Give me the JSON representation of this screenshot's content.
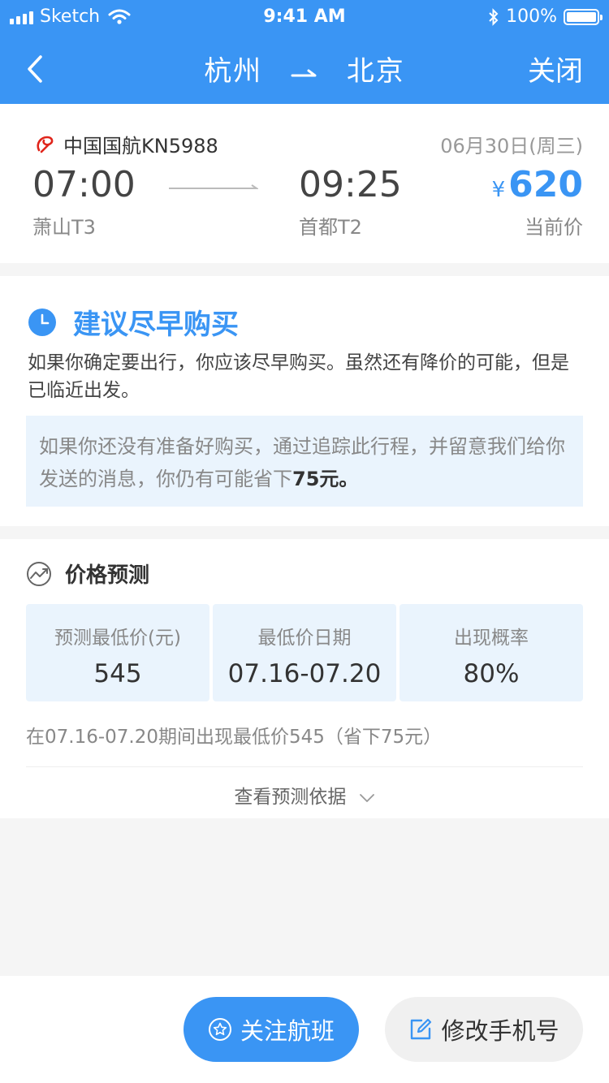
{
  "status_bar": {
    "carrier": "Sketch",
    "time": "9:41 AM",
    "battery": "100%"
  },
  "nav": {
    "origin": "杭州",
    "destination": "北京",
    "close_label": "关闭"
  },
  "flight": {
    "airline": "中国国航KN5988",
    "date": "06月30日(周三)",
    "dep_time": "07:00",
    "arr_time": "09:25",
    "dep_airport": "萧山T3",
    "arr_airport": "首都T2",
    "price_symbol": "¥",
    "price": "620",
    "price_label": "当前价"
  },
  "advice": {
    "title": "建议尽早购买",
    "text": "如果你确定要出行，你应该尽早购买。虽然还有降价的可能，但是已临近出发。",
    "tip_prefix": "如果你还没有准备好购买，通过追踪此行程，并留意我们给你发送的消息，你仍有可能省下",
    "tip_highlight": "75元。"
  },
  "prediction": {
    "title": "价格预测",
    "stats": [
      {
        "label": "预测最低价(元)",
        "value": "545"
      },
      {
        "label": "最低价日期",
        "value": "07.16-07.20"
      },
      {
        "label": "出现概率",
        "value": "80%"
      }
    ],
    "summary": "在07.16-07.20期间出现最低价545（省下75元）",
    "view_basis_label": "查看预测依据"
  },
  "actions": {
    "follow_label": "关注航班",
    "edit_phone_label": "修改手机号"
  },
  "colors": {
    "accent": "#3a95f4",
    "tip_background": "#eaf4fd",
    "page_background": "#f5f5f5"
  }
}
